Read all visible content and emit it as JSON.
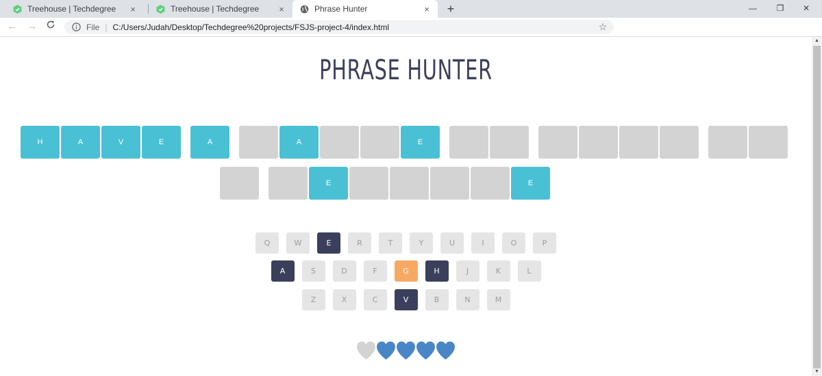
{
  "browser": {
    "tabs": [
      {
        "title": "Treehouse | Techdegree",
        "close": "×"
      },
      {
        "title": "Treehouse | Techdegree",
        "close": "×"
      },
      {
        "title": "Phrase Hunter",
        "close": "×"
      }
    ],
    "new_tab": "+",
    "window_controls": {
      "minimize": "—",
      "restore": "❐",
      "close": "✕"
    },
    "nav": {
      "back": "←",
      "forward": "→",
      "reload": "C"
    },
    "address": {
      "scheme_label": "File",
      "separator": "|",
      "url": "C:/Users/Judah/Desktop/Techdegree%20projects/FSJS-project-4/index.html",
      "star": "☆"
    }
  },
  "game": {
    "title": "PHRASE HUNTER",
    "phrase_rows": [
      [
        [
          "H",
          "A",
          "V",
          "E"
        ],
        [
          "A"
        ],
        [
          "",
          "A",
          "",
          "",
          "E"
        ],
        [
          "",
          ""
        ],
        [
          "",
          "",
          "",
          ""
        ],
        [
          "",
          ""
        ]
      ],
      [
        [
          ""
        ],
        [
          "",
          "E",
          "",
          "",
          "",
          "",
          "E"
        ]
      ]
    ],
    "keyboard": [
      [
        {
          "key": "Q",
          "state": "default"
        },
        {
          "key": "W",
          "state": "default"
        },
        {
          "key": "E",
          "state": "chosen"
        },
        {
          "key": "R",
          "state": "default"
        },
        {
          "key": "T",
          "state": "default"
        },
        {
          "key": "Y",
          "state": "default"
        },
        {
          "key": "U",
          "state": "default"
        },
        {
          "key": "I",
          "state": "default"
        },
        {
          "key": "O",
          "state": "default"
        },
        {
          "key": "P",
          "state": "default"
        }
      ],
      [
        {
          "key": "A",
          "state": "chosen"
        },
        {
          "key": "S",
          "state": "default"
        },
        {
          "key": "D",
          "state": "default"
        },
        {
          "key": "F",
          "state": "default"
        },
        {
          "key": "G",
          "state": "wrong"
        },
        {
          "key": "H",
          "state": "chosen"
        },
        {
          "key": "J",
          "state": "default"
        },
        {
          "key": "K",
          "state": "default"
        },
        {
          "key": "L",
          "state": "default"
        }
      ],
      [
        {
          "key": "Z",
          "state": "default"
        },
        {
          "key": "X",
          "state": "default"
        },
        {
          "key": "C",
          "state": "default"
        },
        {
          "key": "V",
          "state": "chosen"
        },
        {
          "key": "B",
          "state": "default"
        },
        {
          "key": "N",
          "state": "default"
        },
        {
          "key": "M",
          "state": "default"
        }
      ]
    ],
    "lives": [
      "lost",
      "live",
      "live",
      "live",
      "live"
    ],
    "colors": {
      "title": "#3a3f5c",
      "shown_letter": "#4ac0d5",
      "hidden_letter": "#d3d3d3",
      "key_default": "#e5e5e5",
      "key_chosen": "#3a3f5c",
      "key_wrong": "#f7a964",
      "heart_live": "#4a86c6",
      "heart_lost": "#d3d3d3"
    }
  }
}
